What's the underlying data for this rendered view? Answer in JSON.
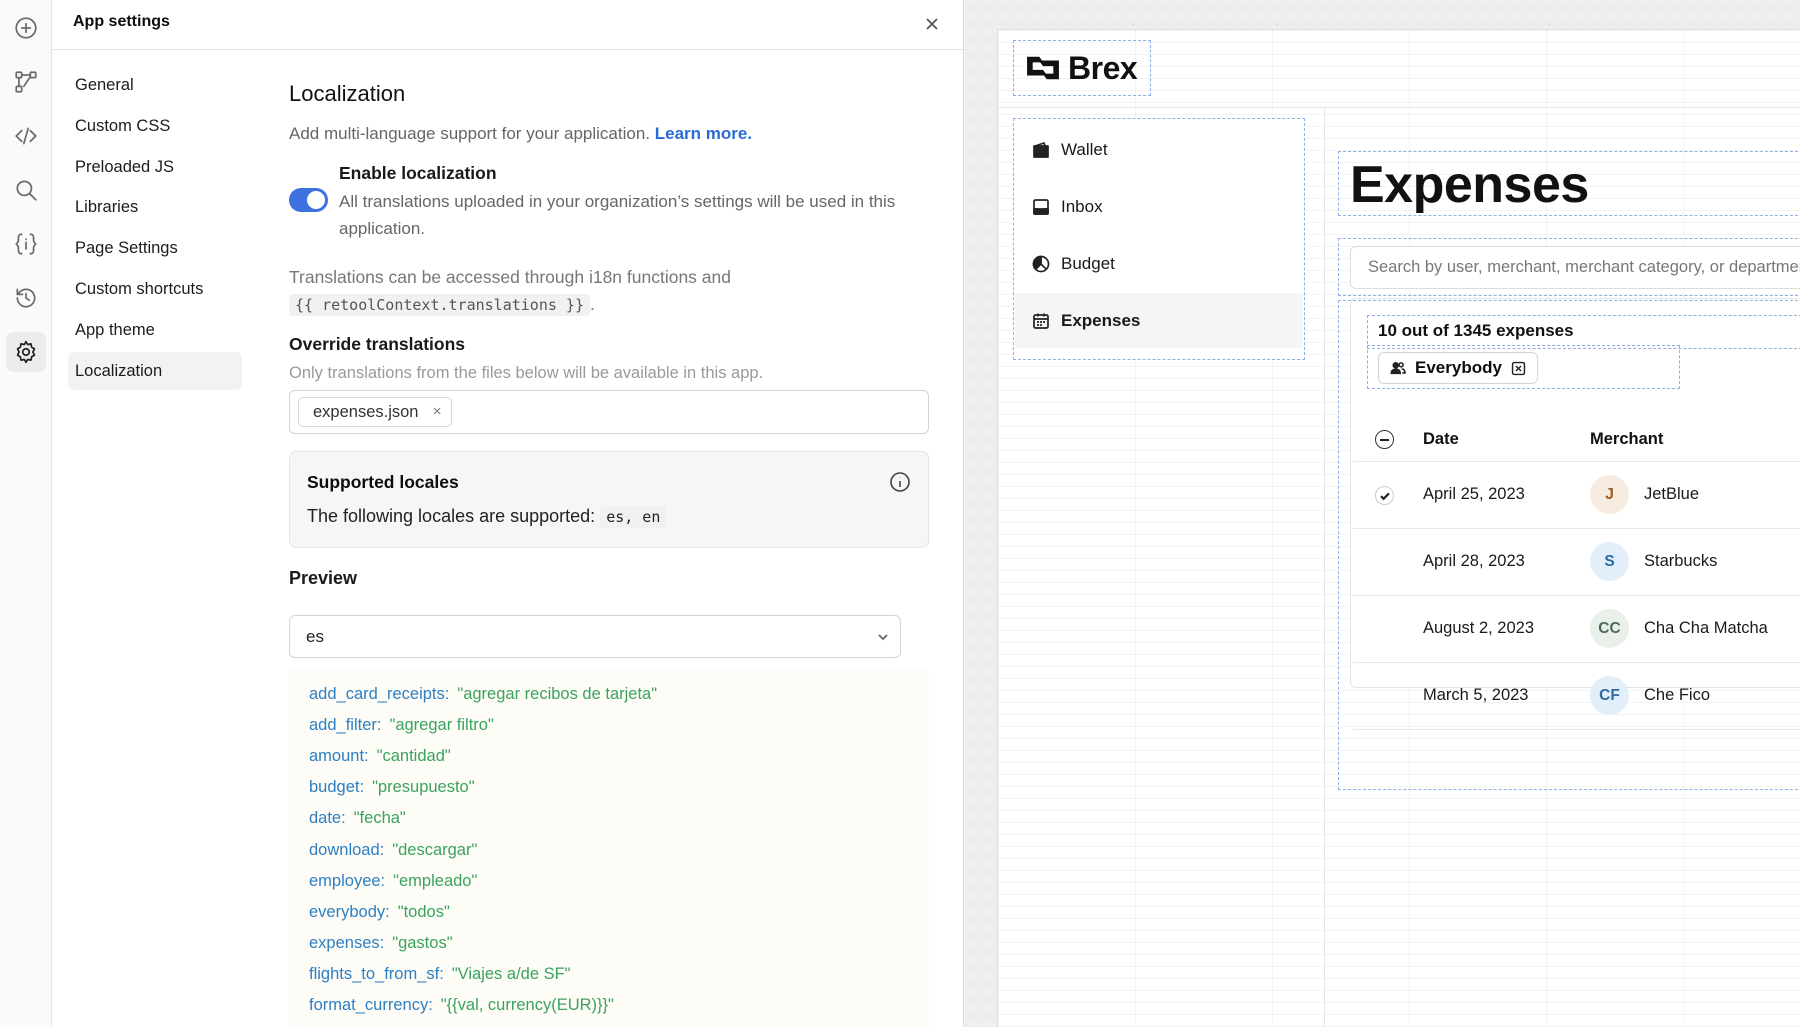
{
  "rail": {
    "icons": [
      "add-icon",
      "flow-icon",
      "code-icon",
      "search-icon",
      "state-icon",
      "history-icon",
      "settings-icon"
    ]
  },
  "panel": {
    "title": "App settings",
    "nav": [
      "General",
      "Custom CSS",
      "Preloaded JS",
      "Libraries",
      "Page Settings",
      "Custom shortcuts",
      "App theme",
      "Localization"
    ],
    "active_nav": "Localization"
  },
  "localization": {
    "heading": "Localization",
    "description": "Add multi-language support for your application.",
    "learn_more": "Learn more.",
    "enable_title": "Enable localization",
    "enable_on": true,
    "enable_desc": "All translations uploaded in your organization’s settings will be used in this application.",
    "trans_info_prefix": "Translations can be accessed through i18n functions and",
    "trans_info_code": "{{ retoolContext.translations }}",
    "trans_info_suffix": ".",
    "override_heading": "Override translations",
    "override_help": "Only translations from the files below will be available in this app.",
    "file_chip": "expenses.json",
    "file_chip_remove": "×",
    "supported_title": "Supported locales",
    "supported_text": "The following locales are supported:",
    "supported_codes": "es, en",
    "preview_heading": "Preview",
    "preview_value": "es",
    "entries": [
      {
        "key": "add_card_receipts:",
        "value": "\"agregar recibos de tarjeta\""
      },
      {
        "key": "add_filter:",
        "value": "\"agregar filtro\""
      },
      {
        "key": "amount:",
        "value": "\"cantidad\""
      },
      {
        "key": "budget:",
        "value": "\"presupuesto\""
      },
      {
        "key": "date:",
        "value": "\"fecha\""
      },
      {
        "key": "download:",
        "value": "\"descargar\""
      },
      {
        "key": "employee:",
        "value": "\"empleado\""
      },
      {
        "key": "everybody:",
        "value": "\"todos\""
      },
      {
        "key": "expenses:",
        "value": "\"gastos\""
      },
      {
        "key": "flights_to_from_sf:",
        "value": "\"Viajes a/de SF\""
      },
      {
        "key": "format_currency:",
        "value": "\"{{val, currency(EUR)}}\""
      }
    ]
  },
  "app": {
    "brand": "Brex",
    "nav": [
      {
        "label": "Wallet",
        "icon": "wallet-icon"
      },
      {
        "label": "Inbox",
        "icon": "inbox-icon"
      },
      {
        "label": "Budget",
        "icon": "budget-icon"
      },
      {
        "label": "Expenses",
        "icon": "calendar-icon"
      }
    ],
    "active_nav": "Expenses",
    "page_title": "Expenses",
    "search_placeholder": "Search by user, merchant, merchant category, or department",
    "count_text": "10 out of 1345 expenses",
    "filter_label": "Everybody",
    "columns": [
      "Date",
      "Merchant"
    ],
    "rows": [
      {
        "date": "April 25, 2023",
        "initials": "J",
        "merchant": "JetBlue",
        "avatar_bg": "#f8ece0",
        "avatar_fg": "#9b5a22",
        "checked": true
      },
      {
        "date": "April 28, 2023",
        "initials": "S",
        "merchant": "Starbucks",
        "avatar_bg": "#e2eef9",
        "avatar_fg": "#2d6aa3",
        "checked": false
      },
      {
        "date": "August 2, 2023",
        "initials": "CC",
        "merchant": "Cha Cha Matcha",
        "avatar_bg": "#e9efe9",
        "avatar_fg": "#4e6a55",
        "checked": false
      },
      {
        "date": "March 5, 2023",
        "initials": "CF",
        "merchant": "Che Fico",
        "avatar_bg": "#e2eef9",
        "avatar_fg": "#2d6aa3",
        "checked": false
      }
    ]
  },
  "colors": {
    "accent": "#3d72e0",
    "key_blue": "#2d7fc4",
    "value_green": "#3aa35d",
    "selection_dash": "#8fb0e6"
  }
}
